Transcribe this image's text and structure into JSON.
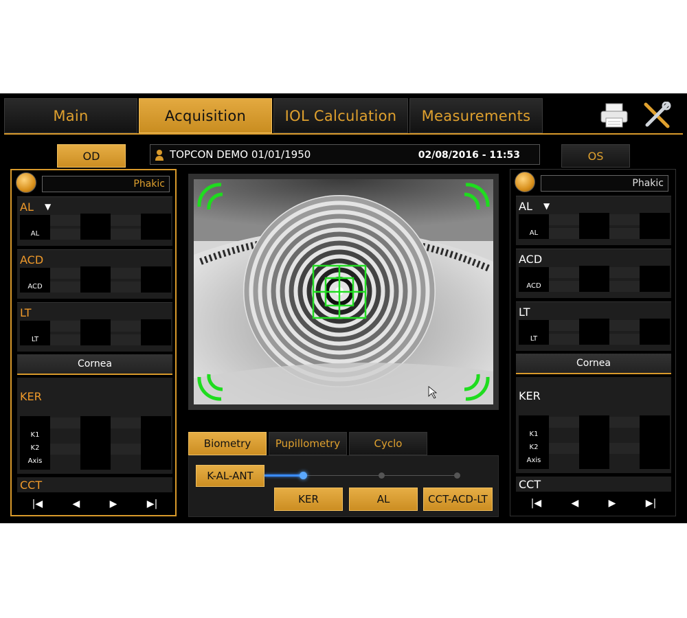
{
  "tabs": [
    {
      "label": "Main",
      "active": false
    },
    {
      "label": "Acquisition",
      "active": true
    },
    {
      "label": "IOL Calculation",
      "active": false
    },
    {
      "label": "Measurements",
      "active": false
    }
  ],
  "toolbar": {
    "print_icon": "printer-icon",
    "settings_icon": "tools-icon"
  },
  "eye_select": {
    "od_label": "OD",
    "os_label": "OS",
    "active": "OD"
  },
  "patient": {
    "name": "TOPCON DEMO 01/01/1950",
    "datetime": "02/08/2016 - 11:53"
  },
  "left_panel": {
    "lens_status": "Phakic",
    "al_title": "AL",
    "al_dropdown": "▼",
    "al_label": "AL",
    "acd_title": "ACD",
    "acd_label": "ACD",
    "lt_title": "LT",
    "lt_label": "LT",
    "cornea_label": "Cornea",
    "ker_title": "KER",
    "ker_rows": [
      "K1",
      "K2",
      "Axis"
    ],
    "cct_title": "CCT",
    "nav": [
      "|◀",
      "◀",
      "▶",
      "▶|"
    ]
  },
  "right_panel": {
    "lens_status": "Phakic",
    "al_title": "AL",
    "al_dropdown": "▼",
    "al_label": "AL",
    "acd_title": "ACD",
    "acd_label": "ACD",
    "lt_title": "LT",
    "lt_label": "LT",
    "cornea_label": "Cornea",
    "ker_title": "KER",
    "ker_rows": [
      "K1",
      "K2",
      "Axis"
    ],
    "cct_title": "CCT",
    "nav": [
      "|◀",
      "◀",
      "▶",
      "▶|"
    ]
  },
  "modes": [
    {
      "label": "Biometry",
      "active": true
    },
    {
      "label": "Pupillometry",
      "active": false
    },
    {
      "label": "Cyclo",
      "active": false
    }
  ],
  "sequence": {
    "main_label": "K-AL-ANT",
    "steps": [
      "KER",
      "AL",
      "CCT-ACD-LT"
    ],
    "progress": 0.2
  },
  "colors": {
    "accent": "#d99a2b",
    "target_green": "#22dd22"
  }
}
